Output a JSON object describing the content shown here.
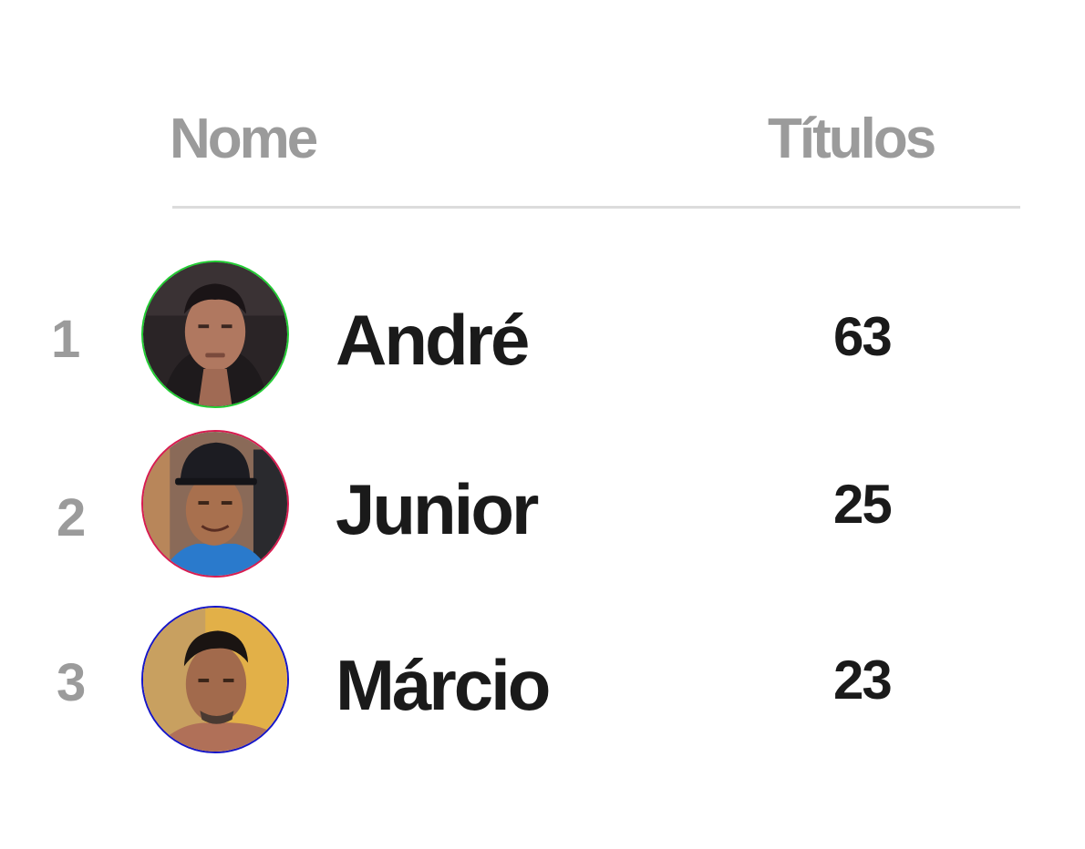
{
  "header": {
    "name_label": "Nome",
    "titles_label": "Títulos"
  },
  "players": [
    {
      "rank": "1",
      "name": "André",
      "titles": "63",
      "ring_color": "#22cc33"
    },
    {
      "rank": "2",
      "name": "Junior",
      "titles": "25",
      "ring_color": "#d81b50"
    },
    {
      "rank": "3",
      "name": "Márcio",
      "titles": "23",
      "ring_color": "#1515c8"
    }
  ]
}
